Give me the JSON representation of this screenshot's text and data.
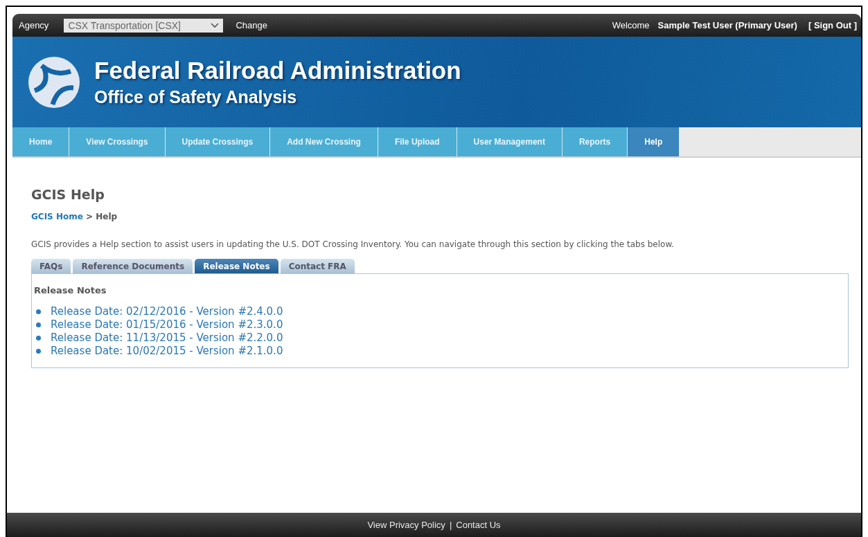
{
  "top_bar": {
    "agency_label": "Agency",
    "agency_select": "CSX Transportation [CSX]",
    "change_link": "Change",
    "welcome": "Welcome",
    "user_name": "Sample Test User (Primary User)",
    "sign_out": "[ Sign Out ]"
  },
  "banner": {
    "title": "Federal Railroad Administration",
    "subtitle": "Office of Safety Analysis"
  },
  "nav": [
    {
      "label": "Home",
      "selected": false
    },
    {
      "label": "View Crossings",
      "selected": false
    },
    {
      "label": "Update Crossings",
      "selected": false
    },
    {
      "label": "Add New Crossing",
      "selected": false
    },
    {
      "label": "File Upload",
      "selected": false
    },
    {
      "label": "User Management",
      "selected": false
    },
    {
      "label": "Reports",
      "selected": false
    },
    {
      "label": "Help",
      "selected": true
    }
  ],
  "page": {
    "title": "GCIS Help",
    "breadcrumb": {
      "link": "GCIS Home",
      "separator": ">",
      "current": "Help"
    },
    "intro": "GCIS provides a Help section to assist users in updating the U.S. DOT Crossing Inventory. You can navigate through this section by clicking the tabs below."
  },
  "tabs": [
    {
      "label": "FAQs",
      "selected": false
    },
    {
      "label": "Reference Documents",
      "selected": false
    },
    {
      "label": "Release Notes",
      "selected": true
    },
    {
      "label": "Contact FRA",
      "selected": false
    }
  ],
  "panel": {
    "heading": "Release Notes",
    "links": [
      "Release Date: 02/12/2016 - Version #2.4.0.0",
      "Release Date: 01/15/2016 - Version #2.3.0.0",
      "Release Date: 11/13/2015 - Version #2.2.0.0",
      "Release Date: 10/02/2015 - Version #2.1.0.0"
    ]
  },
  "footer": {
    "links": [
      "View Privacy Policy",
      "Contact Us"
    ],
    "separator": "|"
  }
}
